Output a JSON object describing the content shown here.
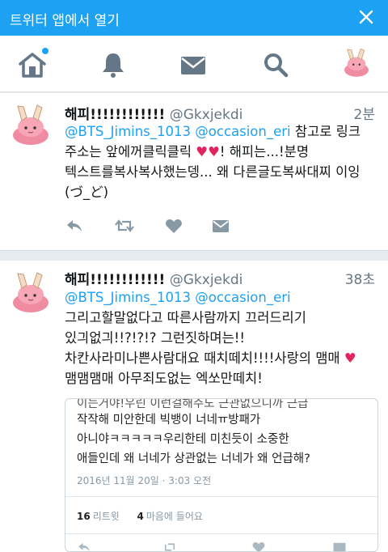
{
  "banner": {
    "title": "트위터 앱에서 열기"
  },
  "nav": {
    "items": [
      "home-icon",
      "notifications-icon",
      "messages-icon",
      "search-icon",
      "profile-avatar"
    ]
  },
  "tweets": [
    {
      "name": "해피!!!!!!!!!!!!",
      "handle": "@Gkxjekdi",
      "time": "2분",
      "mention1": "@BTS_Jimins_1013",
      "mention2": "@occasion_eri",
      "text_a": " 참고로 링크 주소는 앞에꺼클릭클릭",
      "text_b": "! 해피는...!분명 텍스트를복사복사했는뎅... 왜 다른글도복싸대찌 이잉(づ_ど)"
    },
    {
      "name": "해피!!!!!!!!!!!!",
      "handle": "@Gkxjekdi",
      "time": "38초",
      "mention1": "@BTS_Jimins_1013",
      "mention2": "@occasion_eri",
      "text_a": " 그리고할말없다고 따른사람까지 끄러드리기 있긔없긔!!?!?!? 그런짓하며는!! 차칸사라미나쁜사람대요 때치떼치!!!!사랑의 맴매",
      "text_b": "맴맴맴매 아무죄도없는 엑쏘만떼치!",
      "embed": {
        "line0": "이는거야!우린 이런걸해주도 근관없으니까 근급",
        "line1": "작작해 미안한데 빅뱅이 너네ㅠ방패가",
        "line2": "아니야ㅋㅋㅋㅋㅋ우리한테 미친듯이 소중한",
        "line3": "애들인데 왜 너네가 상관없는 너네가 왜 언급해?",
        "date": "2016년 11월 20일 · 3:03 오전",
        "retweets": "16",
        "retweets_label": "리트윗",
        "likes": "4",
        "likes_label": "마음에 들어요"
      }
    }
  ]
}
